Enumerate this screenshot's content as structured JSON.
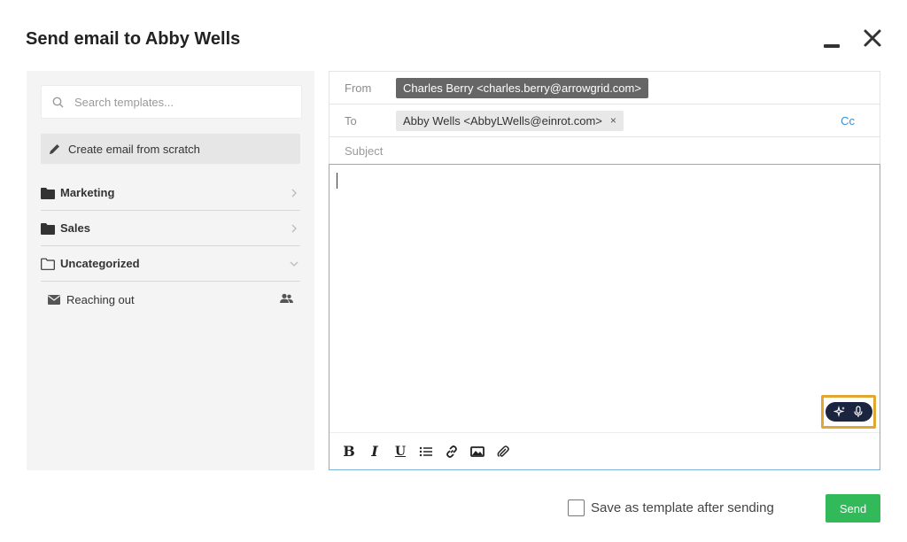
{
  "dialog": {
    "title": "Send email to Abby Wells"
  },
  "templates": {
    "search_placeholder": "Search templates...",
    "create_label": "Create email from scratch",
    "folders": [
      {
        "label": "Marketing",
        "state": "collapsed"
      },
      {
        "label": "Sales",
        "state": "collapsed"
      },
      {
        "label": "Uncategorized",
        "state": "expanded"
      }
    ],
    "items": [
      {
        "label": "Reaching out",
        "shared": true
      }
    ]
  },
  "compose": {
    "from_label": "From",
    "from_value": "Charles Berry <charles.berry@arrowgrid.com>",
    "to_label": "To",
    "to_value": "Abby Wells <AbbyLWells@einrot.com>",
    "remove_symbol": "×",
    "cc_label": "Cc",
    "subject_placeholder": "Subject",
    "subject_value": "",
    "body_value": ""
  },
  "toolbar": {
    "bold": "B",
    "italic": "I",
    "underline": "U"
  },
  "footer": {
    "save_template_label": "Save as template after sending",
    "save_template_checked": false,
    "send_label": "Send"
  },
  "colors": {
    "send_button": "#31b95a",
    "cc_link": "#3a8fcf",
    "editor_border": "#79b3d9",
    "ai_pill": "#1c2540",
    "highlight": "#e0a733",
    "from_chip": "#666666"
  }
}
